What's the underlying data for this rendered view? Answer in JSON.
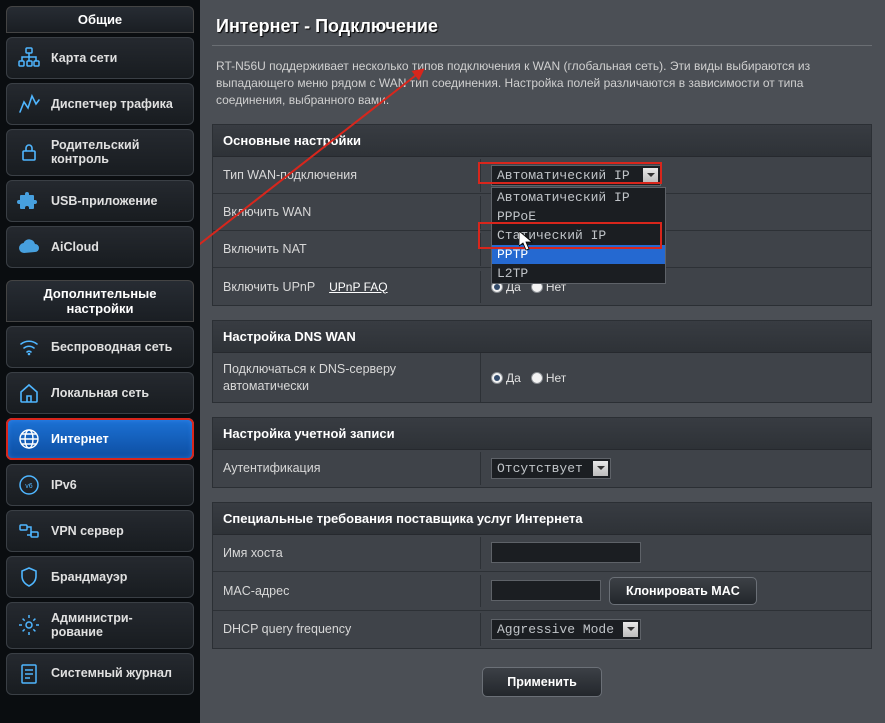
{
  "sidebar": {
    "general_header": "Общие",
    "advanced_header": "Дополнительные настройки",
    "general": [
      {
        "label": "Карта сети"
      },
      {
        "label": "Диспетчер трафика"
      },
      {
        "label": "Родительский контроль"
      },
      {
        "label": "USB-приложение"
      },
      {
        "label": "AiCloud"
      }
    ],
    "advanced": [
      {
        "label": "Беспроводная сеть"
      },
      {
        "label": "Локальная сеть"
      },
      {
        "label": "Интернет"
      },
      {
        "label": "IPv6"
      },
      {
        "label": "VPN сервер"
      },
      {
        "label": "Брандмауэр"
      },
      {
        "label": "Администри-рование"
      },
      {
        "label": "Системный журнал"
      }
    ]
  },
  "page": {
    "title": "Интернет - Подключение",
    "description": "RT-N56U поддерживает несколько типов подключения к WAN (глобальная сеть). Эти виды выбираются из выпадающего меню рядом с WAN тип соединения. Настройка полей различаются в зависимости от типа соединения, выбранного вами."
  },
  "groups": {
    "basic_header": "Основные настройки",
    "rows_basic": {
      "wan_type_label": "Тип WAN-подключения",
      "wan_type_value": "Автоматический IP",
      "wan_type_options": [
        "Автоматический IP",
        "PPPoE",
        "Статический IP",
        "PPTP",
        "L2TP"
      ],
      "enable_wan_label": "Включить WAN",
      "enable_nat_label": "Включить NAT",
      "enable_upnp_label": "Включить UPnP",
      "upnp_link": "UPnP  FAQ"
    },
    "dns_header": "Настройка DNS WAN",
    "dns_row_label": "Подключаться к DNS-серверу автоматически",
    "account_header": "Настройка учетной записи",
    "auth_label": "Аутентификация",
    "auth_value": "Отсутствует",
    "isp_header": "Специальные требования поставщика услуг Интернета",
    "hostname_label": "Имя хоста",
    "hostname_value": "",
    "mac_label": "MAC-адрес",
    "mac_value": "",
    "clone_mac_btn": "Клонировать MAC",
    "dhcp_label": "DHCP query frequency",
    "dhcp_value": "Aggressive Mode"
  },
  "radio": {
    "yes": "Да",
    "no": "Нет"
  },
  "apply_btn": "Применить"
}
